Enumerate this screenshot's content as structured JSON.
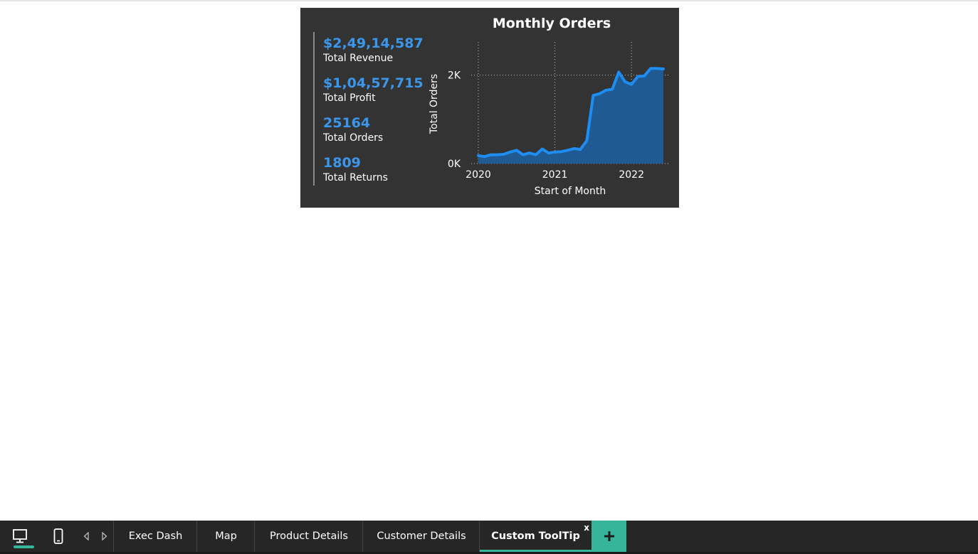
{
  "tooltip": {
    "kpis": [
      {
        "value": "$2,49,14,587",
        "label": "Total Revenue"
      },
      {
        "value": "$1,04,57,715",
        "label": "Total Profit"
      },
      {
        "value": "25164",
        "label": "Total Orders"
      },
      {
        "value": "1809",
        "label": "Total Returns"
      }
    ]
  },
  "chart_data": {
    "type": "area",
    "title": "Monthly Orders",
    "xlabel": "Start of Month",
    "ylabel": "Total Orders",
    "x_ticks": [
      "2020",
      "2021",
      "2022"
    ],
    "y_ticks": [
      "0K",
      "2K"
    ],
    "ylim": [
      0,
      2750
    ],
    "grid": true,
    "series": [
      {
        "x": [
          "2020-01",
          "2020-02",
          "2020-03",
          "2020-04",
          "2020-05",
          "2020-06",
          "2020-07",
          "2020-08",
          "2020-09",
          "2020-10",
          "2020-11",
          "2020-12",
          "2021-01",
          "2021-02",
          "2021-03",
          "2021-04",
          "2021-05",
          "2021-06",
          "2021-07",
          "2021-08",
          "2021-09",
          "2021-10",
          "2021-11",
          "2021-12",
          "2022-01",
          "2022-02",
          "2022-03",
          "2022-04",
          "2022-05",
          "2022-06"
        ],
        "values": [
          180,
          160,
          200,
          200,
          210,
          260,
          300,
          200,
          240,
          200,
          330,
          240,
          260,
          270,
          300,
          340,
          320,
          520,
          1540,
          1580,
          1660,
          1680,
          2070,
          1850,
          1790,
          1970,
          1980,
          2150,
          2150,
          2140
        ]
      }
    ],
    "colors": {
      "line": "#1e8cf0",
      "fill": "#1f5a92",
      "background": "#333333"
    }
  },
  "tabbar": {
    "tabs": [
      {
        "label": "Exec Dash"
      },
      {
        "label": "Map"
      },
      {
        "label": "Product Details"
      },
      {
        "label": "Customer Details"
      },
      {
        "label": "Custom ToolTip"
      }
    ],
    "close_label": "x",
    "icons": {
      "desktop": "desktop-icon",
      "mobile": "mobile-icon",
      "prev": "arrow-left-icon",
      "next": "arrow-right-icon",
      "add": "plus-icon"
    },
    "accent_color": "#37b59a"
  }
}
